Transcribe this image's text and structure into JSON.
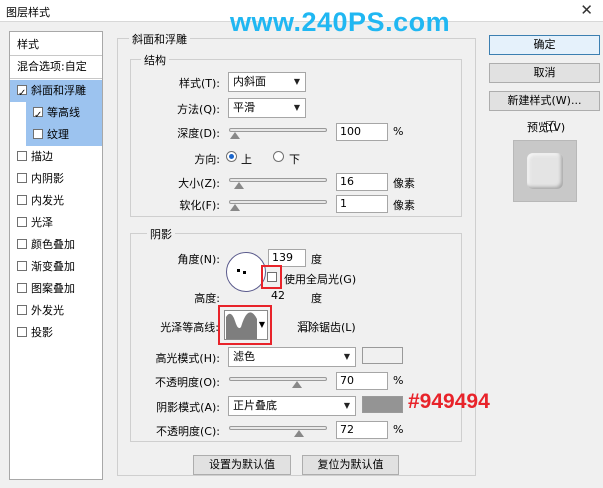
{
  "window": {
    "title": "图层样式",
    "close": "✕"
  },
  "watermark": "www.240PS.com",
  "sidebar": {
    "header": "样式",
    "blend_options": "混合选项:自定",
    "items": [
      {
        "label": "斜面和浮雕",
        "checked": true
      },
      {
        "label": "等高线",
        "checked": true
      },
      {
        "label": "纹理",
        "checked": false
      },
      {
        "label": "描边",
        "checked": false
      },
      {
        "label": "内阴影",
        "checked": false
      },
      {
        "label": "内发光",
        "checked": false
      },
      {
        "label": "光泽",
        "checked": false
      },
      {
        "label": "颜色叠加",
        "checked": false
      },
      {
        "label": "渐变叠加",
        "checked": false
      },
      {
        "label": "图案叠加",
        "checked": false
      },
      {
        "label": "外发光",
        "checked": false
      },
      {
        "label": "投影",
        "checked": false
      }
    ]
  },
  "main": {
    "section_title": "斜面和浮雕",
    "structure": {
      "title": "结构",
      "style_label": "样式(T):",
      "style_value": "内斜面",
      "method_label": "方法(Q):",
      "method_value": "平滑",
      "depth_label": "深度(D):",
      "depth_value": "100",
      "depth_unit": "%",
      "direction_label": "方向:",
      "dir_up": "上",
      "dir_down": "下",
      "size_label": "大小(Z):",
      "size_value": "16",
      "size_unit": "像素",
      "soften_label": "软化(F):",
      "soften_value": "1",
      "soften_unit": "像素"
    },
    "shading": {
      "title": "阴影",
      "angle_label": "角度(N):",
      "angle_value": "139",
      "angle_unit": "度",
      "global_light_label": "使用全局光(G)",
      "altitude_label": "高度:",
      "altitude_value": "42",
      "altitude_unit": "度",
      "gloss_contour_label": "光泽等高线:",
      "antialias_label": "消除锯齿(L)",
      "highlight_mode_label": "高光模式(H):",
      "highlight_mode_value": "滤色",
      "highlight_color": "#ffffff",
      "highlight_opacity_label": "不透明度(O):",
      "highlight_opacity_value": "70",
      "highlight_opacity_unit": "%",
      "shadow_mode_label": "阴影模式(A):",
      "shadow_mode_value": "正片叠底",
      "shadow_color": "#949494",
      "shadow_color_annotation": "#949494",
      "shadow_opacity_label": "不透明度(C):",
      "shadow_opacity_value": "72",
      "shadow_opacity_unit": "%"
    },
    "make_default": "设置为默认值",
    "reset_default": "复位为默认值"
  },
  "right": {
    "ok": "确定",
    "cancel": "取消",
    "new_style": "新建样式(W)...",
    "preview_label": "预览(V)",
    "preview_checked": true
  },
  "colors": {
    "accent_selection": "#9cc3ef",
    "annotation_red": "#e8232a",
    "watermark": "#20b7f2"
  }
}
